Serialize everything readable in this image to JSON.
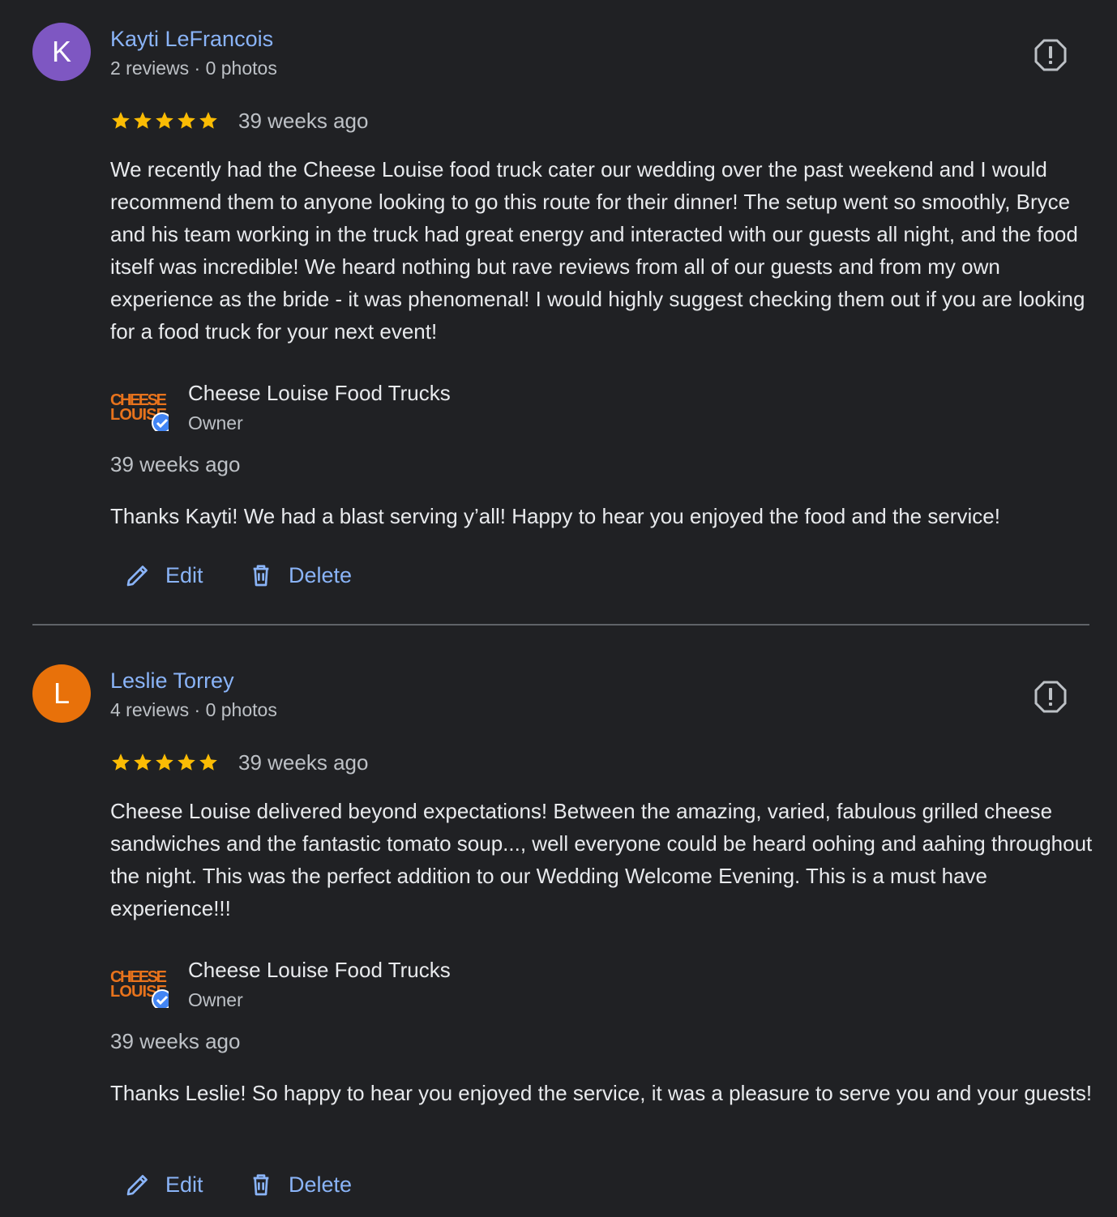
{
  "colors": {
    "background": "#202124",
    "link": "#8ab4f8",
    "star": "#fbbc04",
    "verified": "#4285f4"
  },
  "reviews": [
    {
      "avatar_letter": "K",
      "avatar_color": "#7e57c2",
      "name": "Kayti LeFrancois",
      "meta": "2 reviews · 0 photos",
      "rating": 5,
      "date": "39 weeks ago",
      "text": "We recently had the Cheese Louise food truck cater our wedding over the past weekend and I would recommend them to anyone looking to go this route for their dinner! The setup went so smoothly, Bryce and his team working in the truck had great energy and interacted with our guests all night, and the food itself was incredible! We heard nothing but rave reviews from all of our guests and from my own experience as the bride - it was phenomenal! I would highly suggest checking them out if you are looking for a food truck for your next event!",
      "reply": {
        "owner_name": "Cheese Louise Food Trucks",
        "owner_role": "Owner",
        "logo_text_top": "CHEESE",
        "logo_text_bottom": "LOUISE",
        "date": "39 weeks ago",
        "text": "Thanks Kayti! We had a blast serving y’all! Happy to hear you enjoyed the food and the service!"
      },
      "actions": {
        "edit_label": "Edit",
        "delete_label": "Delete"
      }
    },
    {
      "avatar_letter": "L",
      "avatar_color": "#e8710a",
      "name": "Leslie Torrey",
      "meta": "4 reviews · 0 photos",
      "rating": 5,
      "date": "39 weeks ago",
      "text": "Cheese Louise delivered beyond expectations! Between the amazing, varied, fabulous grilled cheese sandwiches and the fantastic tomato soup..., well everyone could be heard oohing and aahing throughout the night. This was the perfect addition to our Wedding Welcome Evening. This is a must have experience!!!",
      "reply": {
        "owner_name": "Cheese Louise Food Trucks",
        "owner_role": "Owner",
        "logo_text_top": "CHEESE",
        "logo_text_bottom": "LOUISE",
        "date": "39 weeks ago",
        "text": "Thanks Leslie! So happy to hear you enjoyed the service, it was a pleasure to serve you and your guests!"
      },
      "actions": {
        "edit_label": "Edit",
        "delete_label": "Delete"
      }
    }
  ]
}
